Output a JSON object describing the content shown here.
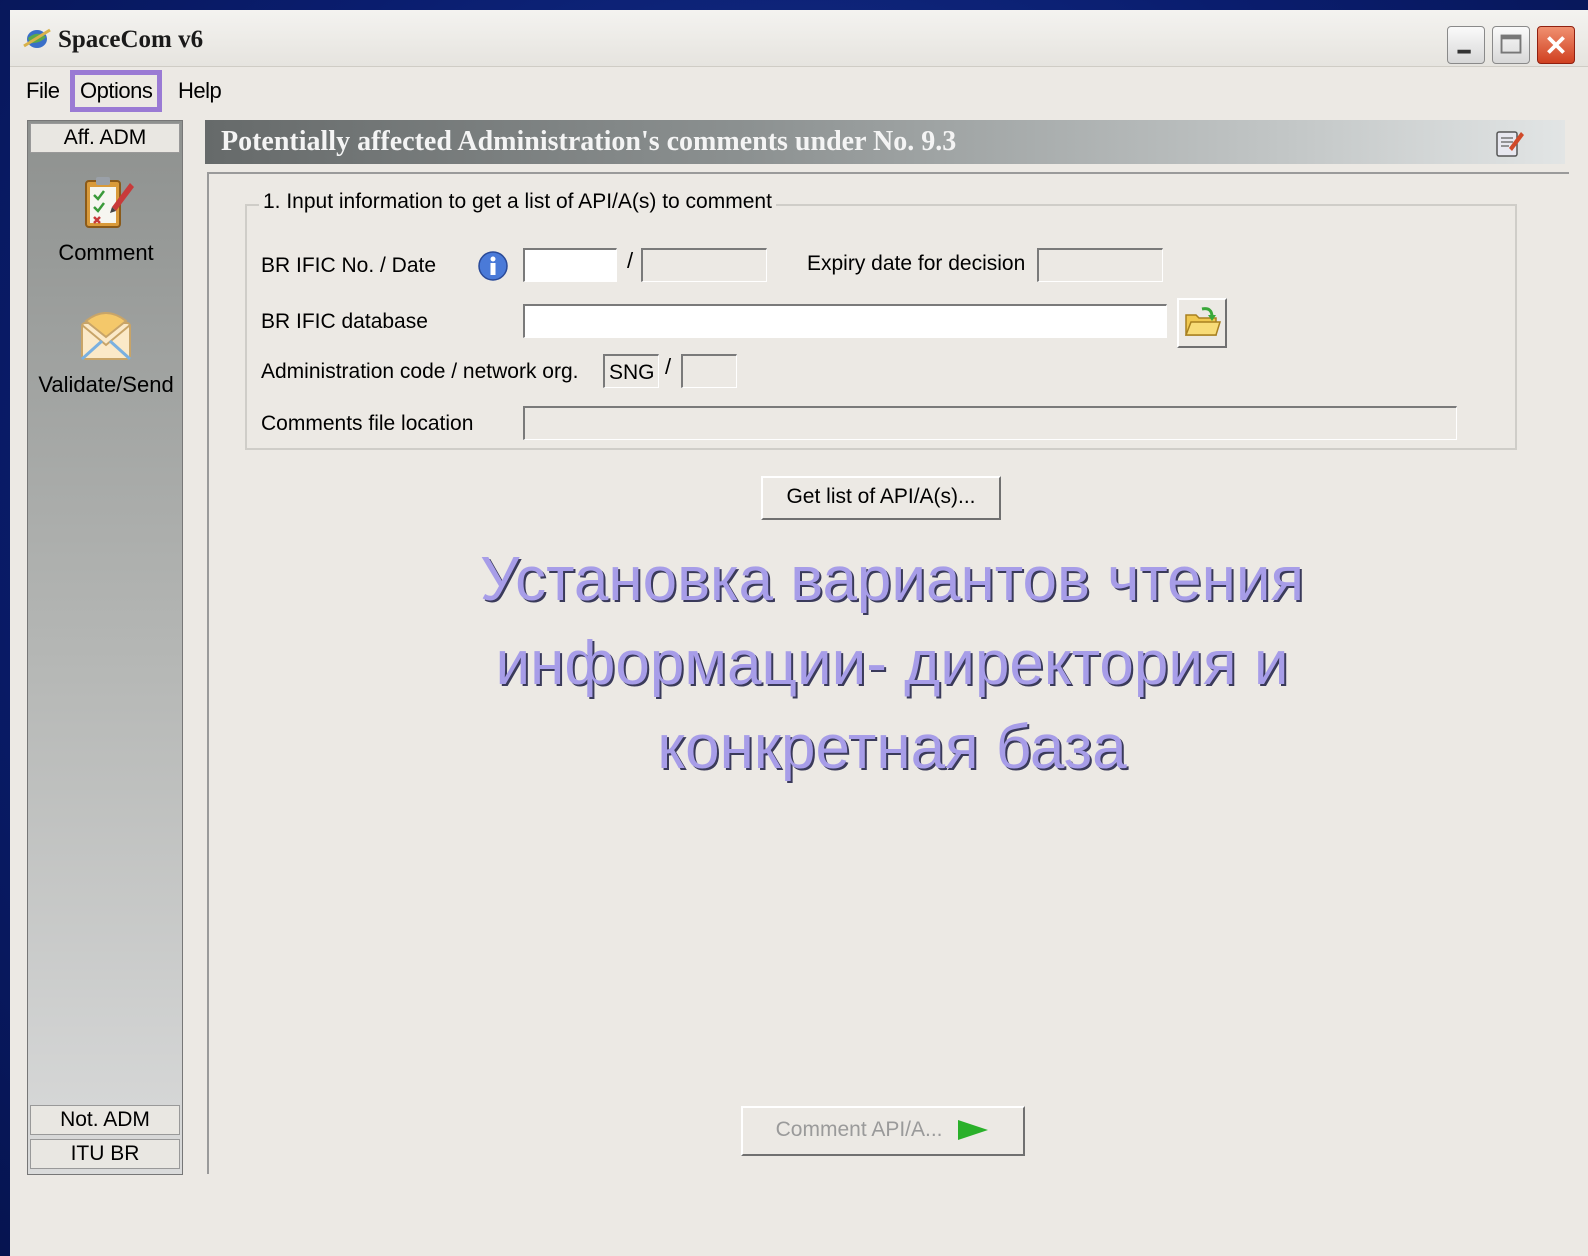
{
  "window": {
    "title": "SpaceCom v6"
  },
  "menu": {
    "file": "File",
    "options": "Options",
    "help": "Help"
  },
  "sidebar": {
    "top_tab": "Aff. ADM",
    "tools": [
      {
        "label": "Comment",
        "icon": "clipboard-edit-icon"
      },
      {
        "label": "Validate/Send",
        "icon": "envelope-icon"
      }
    ],
    "bottom_tabs": [
      "Not. ADM",
      "ITU BR"
    ]
  },
  "panel": {
    "title": "Potentially affected Administration's comments under No. 9.3",
    "group_title": "1. Input information to get a list of API/A(s) to comment",
    "labels": {
      "ific_no_date": "BR IFIC No. / Date",
      "expiry": "Expiry date for decision",
      "database": "BR IFIC database",
      "admin_code": "Administration code / network org.",
      "comments_location": "Comments file location"
    },
    "values": {
      "ific_no": "",
      "ific_date": "",
      "expiry": "",
      "database": "",
      "admin_code": "SNG",
      "network_org": "",
      "comments_location": ""
    },
    "separator": "/",
    "get_list_button": "Get list of API/A(s)...",
    "comment_button": "Comment API/A..."
  },
  "overlay": {
    "lines": [
      "Установка вариантов чтения",
      "информации- директория и",
      "конкретная база"
    ],
    "color": "#a79de8"
  },
  "colors": {
    "highlight": "#9a7ad4",
    "window_bg": "#ece9e4"
  }
}
